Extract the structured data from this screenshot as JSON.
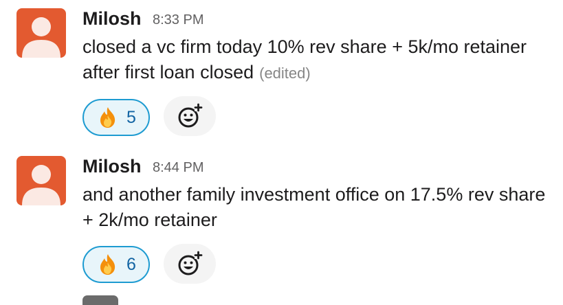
{
  "messages": [
    {
      "author": "Milosh",
      "time": "8:33 PM",
      "text": "closed a vc firm today 10% rev share + 5k/mo retainer after first loan closed",
      "edited_label": "(edited)",
      "reaction": {
        "emoji": "fire-emoji",
        "count": "5"
      }
    },
    {
      "author": "Milosh",
      "time": "8:44 PM",
      "text": "and another family investment office on 17.5% rev share + 2k/mo retainer",
      "reaction": {
        "emoji": "fire-emoji",
        "count": "6"
      }
    }
  ],
  "colors": {
    "avatar_bg": "#e35a30",
    "reaction_border": "#1d9bd1",
    "reaction_bg": "#e8f5fa",
    "reaction_count": "#1264a3"
  }
}
